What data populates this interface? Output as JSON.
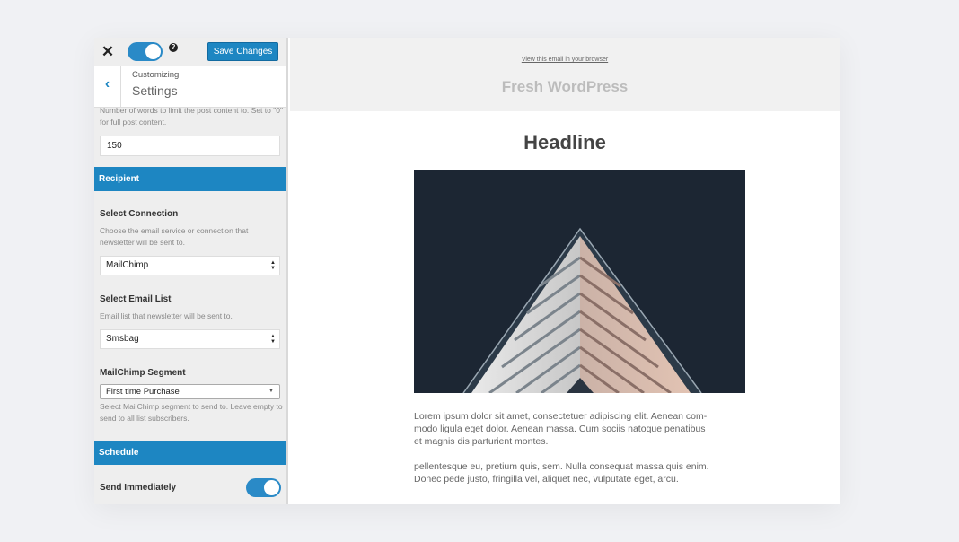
{
  "topbar": {
    "close_label": "✕",
    "help_label": "?",
    "save_label": "Save Changes"
  },
  "customize": {
    "back_label": "‹",
    "context": "Customizing",
    "title": "Settings"
  },
  "post_content": {
    "description": "Number of words to limit the post content to. Set to \"0\" for full post content.",
    "value": "150"
  },
  "recipient": {
    "heading": "Recipient",
    "connection_label": "Select Connection",
    "connection_desc": "Choose the email service or connection that newsletter will be sent to.",
    "connection_value": "MailChimp",
    "list_label": "Select Email List",
    "list_desc": "Email list that newsletter will be sent to.",
    "list_value": "Smsbag",
    "segment_label": "MailChimp Segment",
    "segment_value": "First time Purchase",
    "segment_desc": "Select MailChimp segment to send to. Leave empty to send to all list subscribers."
  },
  "schedule": {
    "heading": "Schedule",
    "send_immediately_label": "Send Immediately",
    "send_immediately_on": true
  },
  "preview": {
    "view_link": "View this email in your browser",
    "site_name": "Fresh WordPress",
    "headline": "Headline",
    "paragraph1_lines": [
      "Lorem ipsum dolor sit amet, consectetuer adipiscing elit. Aenean com-",
      "modo ligula eget dolor. Aenean massa. Cum sociis natoque penatibus",
      "et magnis dis parturient montes."
    ],
    "paragraph2_lines": [
      "pellentesque eu, pretium quis, sem. Nulla consequat massa quis enim.",
      "Donec pede justo, fringilla vel, aliquet nec, vulputate eget, arcu."
    ]
  },
  "colors": {
    "accent": "#1d86c2",
    "toggle": "#2a8ac7",
    "hero_background": "#1c2633"
  }
}
